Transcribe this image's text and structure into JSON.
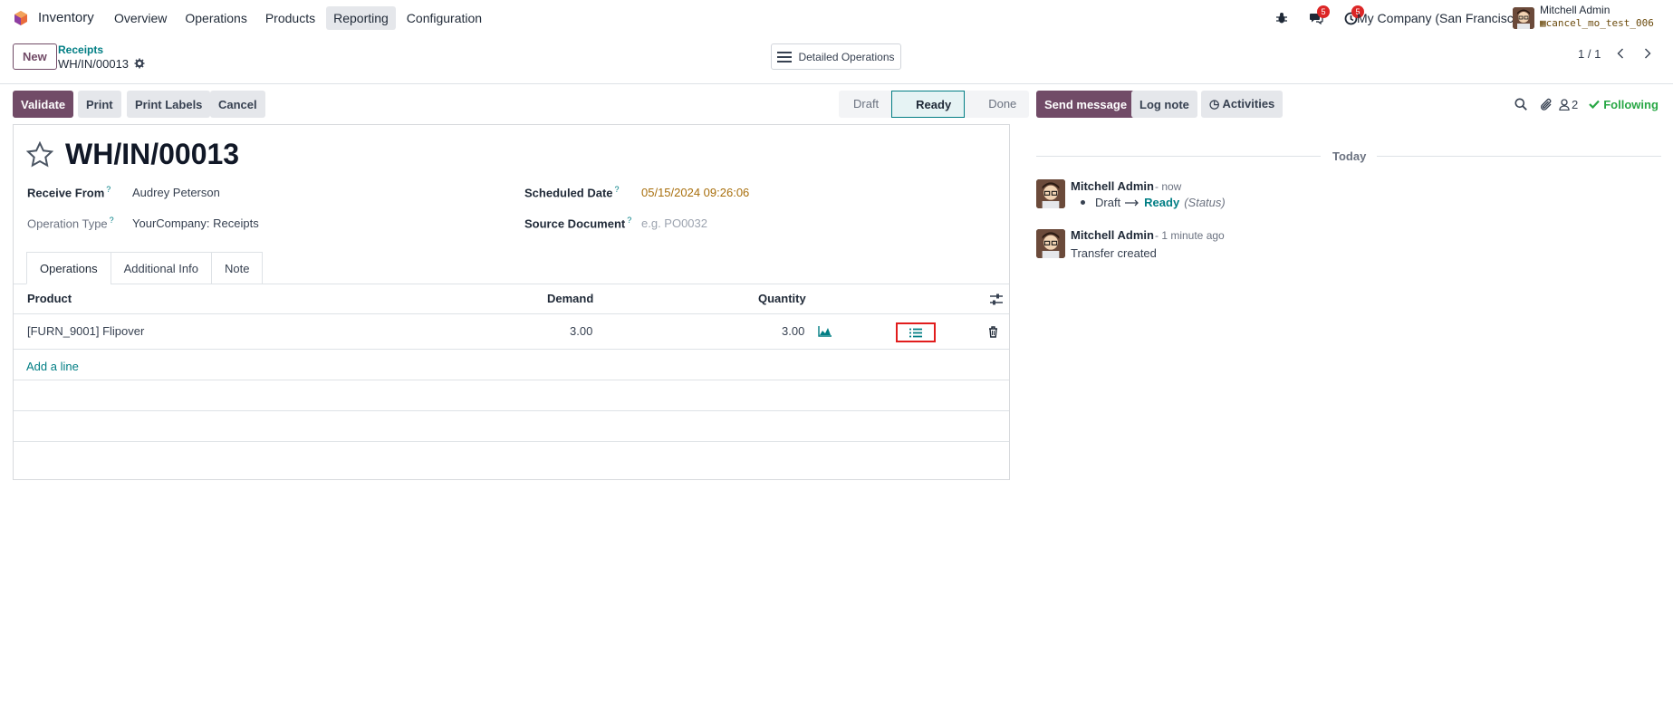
{
  "navbar": {
    "app_name": "Inventory",
    "menu": [
      "Overview",
      "Operations",
      "Products",
      "Reporting",
      "Configuration"
    ],
    "active_menu": "Reporting",
    "messages_badge": "5",
    "activities_badge": "5",
    "company": "My Company (San Francisco)",
    "user_name": "Mitchell Admin",
    "database": "cancel_mo_test_006"
  },
  "control_panel": {
    "new_label": "New",
    "breadcrumb_parent": "Receipts",
    "breadcrumb_current": "WH/IN/00013",
    "detailed_operations_label": "Detailed Operations",
    "pager": "1 / 1"
  },
  "statusbar": {
    "buttons": [
      "Validate",
      "Print",
      "Print Labels",
      "Cancel"
    ],
    "stages": [
      "Draft",
      "Ready",
      "Done"
    ],
    "current_stage": "Ready"
  },
  "form": {
    "title": "WH/IN/00013",
    "fields": {
      "receive_from_label": "Receive From",
      "receive_from_value": "Audrey Peterson",
      "operation_type_label": "Operation Type",
      "operation_type_value": "YourCompany: Receipts",
      "scheduled_date_label": "Scheduled Date",
      "scheduled_date_value": "05/15/2024 09:26:06",
      "source_document_label": "Source Document",
      "source_document_placeholder": "e.g. PO0032",
      "help_mark": "?"
    },
    "tabs": [
      "Operations",
      "Additional Info",
      "Note"
    ],
    "active_tab": "Operations",
    "table": {
      "headers": {
        "product": "Product",
        "demand": "Demand",
        "quantity": "Quantity"
      },
      "rows": [
        {
          "product": "[FURN_9001] Flipover",
          "demand": "3.00",
          "quantity": "3.00"
        }
      ],
      "add_line": "Add a line"
    }
  },
  "chatter": {
    "send_message": "Send message",
    "log_note": "Log note",
    "activities": "Activities",
    "followers_count": "2",
    "following": "Following",
    "date_separator": "Today",
    "messages": [
      {
        "author": "Mitchell Admin",
        "time": "- now",
        "tracking": {
          "old": "Draft",
          "new": "Ready",
          "field": "(Status)"
        }
      },
      {
        "author": "Mitchell Admin",
        "time": "- 1 minute ago",
        "body": "Transfer created"
      }
    ]
  },
  "colors": {
    "brand": "#714b67",
    "teal": "#017e84",
    "highlight_border": "#e11d1d",
    "following_green": "#28a745"
  }
}
